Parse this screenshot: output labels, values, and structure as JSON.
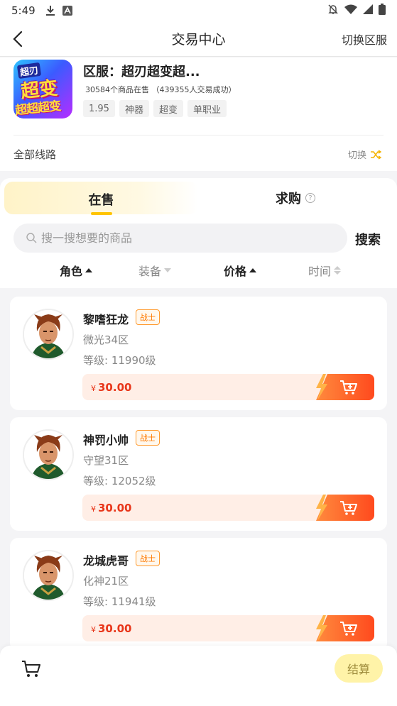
{
  "status_bar": {
    "time": "5:49",
    "icons": [
      "download-icon",
      "app-notification-icon",
      "mute-icon",
      "wifi-icon",
      "signal-icon",
      "battery-icon"
    ]
  },
  "nav": {
    "title": "交易中心",
    "back_icon": "back-arrow-icon",
    "right_action": "切换区服"
  },
  "server": {
    "name": "区服：超刃超变超...",
    "stats": "30584个商品在售 （439355人交易成功）",
    "tags": [
      "1.95",
      "神器",
      "超变",
      "单职业"
    ],
    "icon_text": [
      "超刃",
      "超变",
      "超超超变"
    ],
    "route_label": "全部线路",
    "route_switch": "切换"
  },
  "tabs": {
    "sell": "在售",
    "buy": "求购",
    "help_glyph": "?"
  },
  "search": {
    "placeholder": "搜一搜想要的商品",
    "button": "搜索"
  },
  "sort": [
    {
      "label": "角色",
      "state": "active"
    },
    {
      "label": "装备",
      "state": "inactive"
    },
    {
      "label": "价格",
      "state": "active"
    },
    {
      "label": "时间",
      "state": "inactive"
    }
  ],
  "items": [
    {
      "name": "黎嗜狂龙",
      "class": "战士",
      "zone": "微光34区",
      "level": "等级: 11990级",
      "currency": "¥",
      "price": "30.00"
    },
    {
      "name": "神罚小帅",
      "class": "战士",
      "zone": "守望31区",
      "level": "等级: 12052级",
      "currency": "¥",
      "price": "30.00"
    },
    {
      "name": "龙城虎哥",
      "class": "战士",
      "zone": "化神21区",
      "level": "等级: 11941级",
      "currency": "¥",
      "price": "30.00"
    }
  ],
  "bottom": {
    "cart_icon": "cart-icon",
    "checkout": "结算"
  },
  "colors": {
    "accent_yellow": "#ffc400",
    "price_red": "#e8361a",
    "cart_orange": "#ff5a24",
    "badge_orange": "#ff7a00"
  }
}
